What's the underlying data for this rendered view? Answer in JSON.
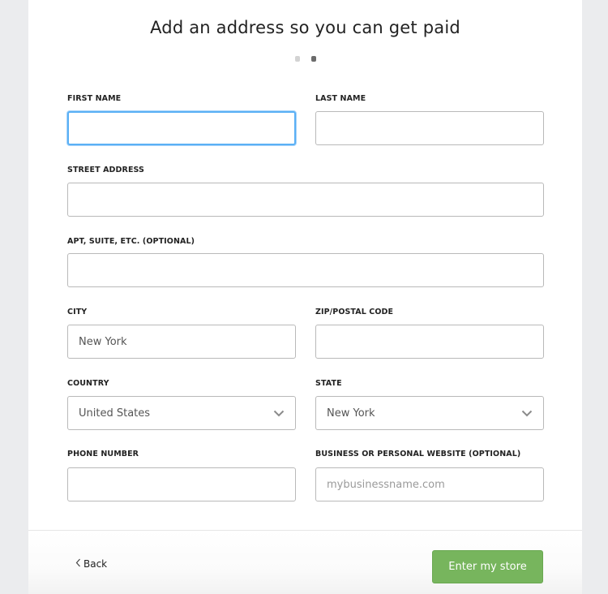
{
  "header": {
    "title": "Add an address so you can get paid",
    "steps": {
      "total": 2,
      "current": 2
    }
  },
  "form": {
    "first_name": {
      "label": "FIRST NAME",
      "value": "",
      "placeholder": "",
      "focused": true
    },
    "last_name": {
      "label": "LAST NAME",
      "value": "",
      "placeholder": ""
    },
    "street_address": {
      "label": "STREET ADDRESS",
      "value": "",
      "placeholder": ""
    },
    "apt": {
      "label": "APT, SUITE, ETC. (OPTIONAL)",
      "value": "",
      "placeholder": ""
    },
    "city": {
      "label": "CITY",
      "value": "New York",
      "placeholder": ""
    },
    "zip": {
      "label": "ZIP/POSTAL CODE",
      "value": "",
      "placeholder": ""
    },
    "country": {
      "label": "COUNTRY",
      "selected": "United States",
      "icon": "chevron-down-icon"
    },
    "state": {
      "label": "STATE",
      "selected": "New York",
      "icon": "chevron-down-icon"
    },
    "phone": {
      "label": "PHONE NUMBER",
      "value": "",
      "placeholder": ""
    },
    "website": {
      "label": "BUSINESS OR PERSONAL WEBSITE (OPTIONAL)",
      "value": "",
      "placeholder": "mybusinessname.com"
    }
  },
  "footer": {
    "back_label": "Back",
    "back_icon": "chevron-left-icon",
    "submit_label": "Enter my store"
  },
  "colors": {
    "accent_green": "#77b55d",
    "focus_blue": "#5ab0f5",
    "background": "#ebecee"
  }
}
